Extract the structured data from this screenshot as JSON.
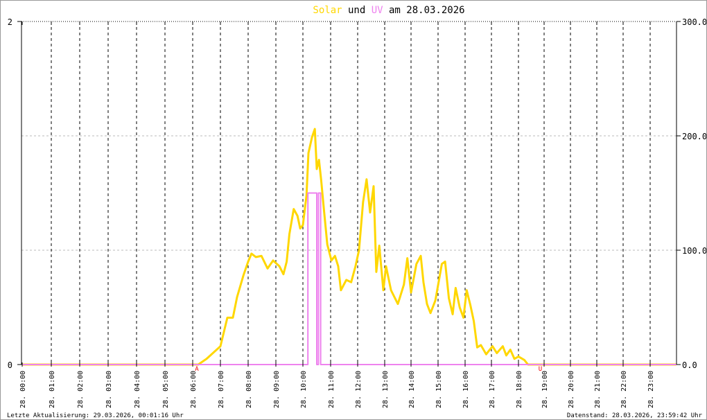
{
  "chart_data": {
    "type": "line",
    "title": {
      "part1": "Solar",
      "part2": " und ",
      "part3": "UV",
      "part4": " am 28.03.2026"
    },
    "left_axis": {
      "label": "UV",
      "ylim": [
        0,
        2
      ],
      "ticks": [
        "2",
        "0"
      ]
    },
    "right_axis": {
      "label": "Solar",
      "ylim": [
        0,
        300
      ],
      "ticks": [
        "300.0",
        "200.0",
        "100.0",
        "0.0"
      ]
    },
    "x_ticks": [
      "28. 00:00",
      "28. 01:00",
      "28. 02:00",
      "28. 03:00",
      "28. 04:00",
      "28. 05:00",
      "28. 06:00",
      "28. 07:00",
      "28. 08:00",
      "28. 09:00",
      "28. 10:00",
      "28. 11:00",
      "28. 12:00",
      "28. 13:00",
      "28. 14:00",
      "28. 15:00",
      "28. 16:00",
      "28. 17:00",
      "28. 18:00",
      "28. 19:00",
      "28. 20:00",
      "28. 21:00",
      "28. 22:00",
      "28. 23:00"
    ],
    "markers": [
      {
        "label": "A",
        "hour": 6.15
      },
      {
        "label": "U",
        "hour": 18.85
      }
    ],
    "series": [
      {
        "name": "Solar",
        "axis": "right",
        "color": "#ffd700",
        "x": [
          0,
          6.2,
          6.5,
          7.0,
          7.25,
          7.45,
          7.6,
          7.83,
          8.0,
          8.12,
          8.28,
          8.48,
          8.7,
          8.9,
          9.13,
          9.28,
          9.4,
          9.5,
          9.66,
          9.8,
          9.9,
          10.0,
          10.13,
          10.2,
          10.33,
          10.43,
          10.5,
          10.58,
          10.66,
          10.76,
          10.88,
          11.03,
          11.16,
          11.28,
          11.38,
          11.58,
          11.76,
          11.92,
          12.05,
          12.2,
          12.33,
          12.46,
          12.59,
          12.69,
          12.8,
          12.95,
          13.05,
          13.24,
          13.5,
          13.73,
          13.86,
          14.0,
          14.2,
          14.36,
          14.46,
          14.59,
          14.72,
          14.9,
          15.14,
          15.26,
          15.4,
          15.54,
          15.65,
          15.8,
          15.94,
          16.06,
          16.2,
          16.33,
          16.46,
          16.6,
          16.8,
          17.04,
          17.2,
          17.42,
          17.55,
          17.7,
          17.85,
          18.0,
          18.23,
          18.37,
          24
        ],
        "y": [
          0,
          0,
          5,
          16,
          41,
          41,
          59,
          78,
          90,
          97,
          94,
          95,
          84,
          91,
          86,
          79,
          90,
          114,
          136,
          130,
          119,
          122,
          148,
          185,
          199,
          206,
          171,
          179,
          161,
          135,
          105,
          91,
          95,
          86,
          65,
          74,
          72,
          86,
          100,
          142,
          162,
          133,
          156,
          81,
          104,
          65,
          86,
          65,
          53,
          70,
          93,
          63,
          88,
          95,
          72,
          53,
          45,
          56,
          88,
          90,
          58,
          44,
          67,
          50,
          41,
          65,
          52,
          38,
          15,
          17,
          9,
          16,
          10,
          16,
          8,
          13,
          5,
          7,
          4,
          0,
          0
        ]
      },
      {
        "name": "UV",
        "axis": "left",
        "color": "#ee82ee",
        "step": true,
        "x": [
          0,
          10.18,
          10.5,
          10.56,
          10.64,
          24
        ],
        "y": [
          0,
          1,
          0,
          1,
          0,
          0
        ]
      }
    ]
  },
  "footer": {
    "left": "Letzte Aktualisierung: 29.03.2026, 00:01:16 Uhr",
    "right": "Datenstand: 28.03.2026, 23:59:42 Uhr"
  }
}
